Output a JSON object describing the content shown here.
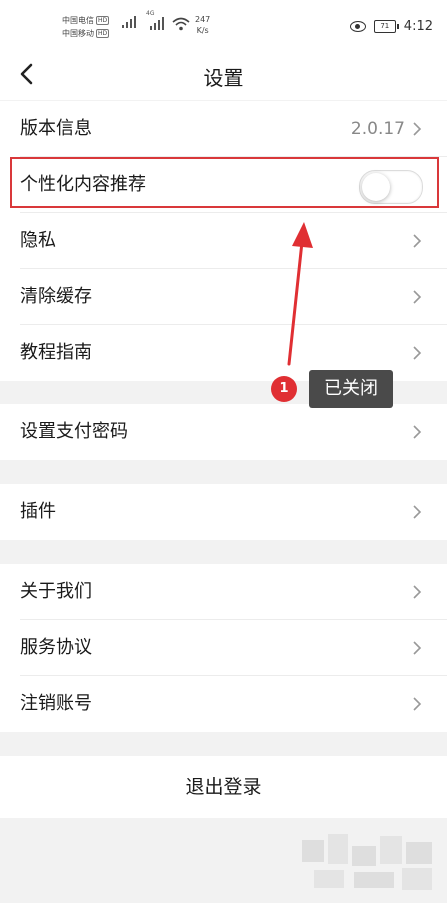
{
  "status_bar": {
    "carrier1": "中国电信",
    "carrier2": "中国移动",
    "hd_badge": "HD",
    "net_type": "4G",
    "net_speed": "247",
    "net_unit": "K/s",
    "battery": "71",
    "time": "4:12"
  },
  "header": {
    "title": "设置"
  },
  "rows": {
    "version": {
      "label": "版本信息",
      "value": "2.0.17"
    },
    "personalized": {
      "label": "个性化内容推荐",
      "toggle_on": false
    },
    "privacy": {
      "label": "隐私"
    },
    "clear_cache": {
      "label": "清除缓存"
    },
    "tutorial": {
      "label": "教程指南"
    },
    "pay_password": {
      "label": "设置支付密码"
    },
    "plugins": {
      "label": "插件"
    },
    "about": {
      "label": "关于我们"
    },
    "service": {
      "label": "服务协议"
    },
    "cancel_account": {
      "label": "注销账号"
    }
  },
  "logout": {
    "label": "退出登录"
  },
  "annotation": {
    "step_number": "1",
    "text": "已关闭",
    "highlight_color": "#d9383a",
    "arrow_color": "#e02f33"
  }
}
